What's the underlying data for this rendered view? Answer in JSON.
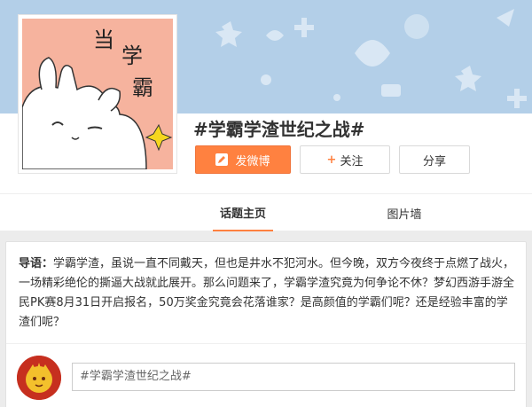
{
  "topic": {
    "title": "#学霸学渣世纪之战#",
    "avatar_text": [
      "当",
      "学",
      "霸"
    ]
  },
  "actions": {
    "post_label": "发微博",
    "follow_label": "关注",
    "share_label": "分享"
  },
  "tabs": [
    {
      "label": "话题主页",
      "active": true
    },
    {
      "label": "图片墙",
      "active": false
    }
  ],
  "intro": {
    "prefix": "导语：",
    "text": "学霸学渣，虽说一直不同戴天，但也是井水不犯河水。但今晚，双方今夜终于点燃了战火，一场精彩绝伦的撕逼大战就此展开。那么问题来了，学霸学渣究竟为何争论不休？梦幻西游手游全民PK赛8月31日开启报名，50万奖金究竟会花落谁家？是高颜值的学霸们呢？还是经验丰富的学渣们呢？"
  },
  "composer": {
    "value": "#学霸学渣世纪之战#"
  },
  "colors": {
    "accent": "#ff8140",
    "banner": "#b3cfe8",
    "avatar_bg": "#f6b39e"
  }
}
